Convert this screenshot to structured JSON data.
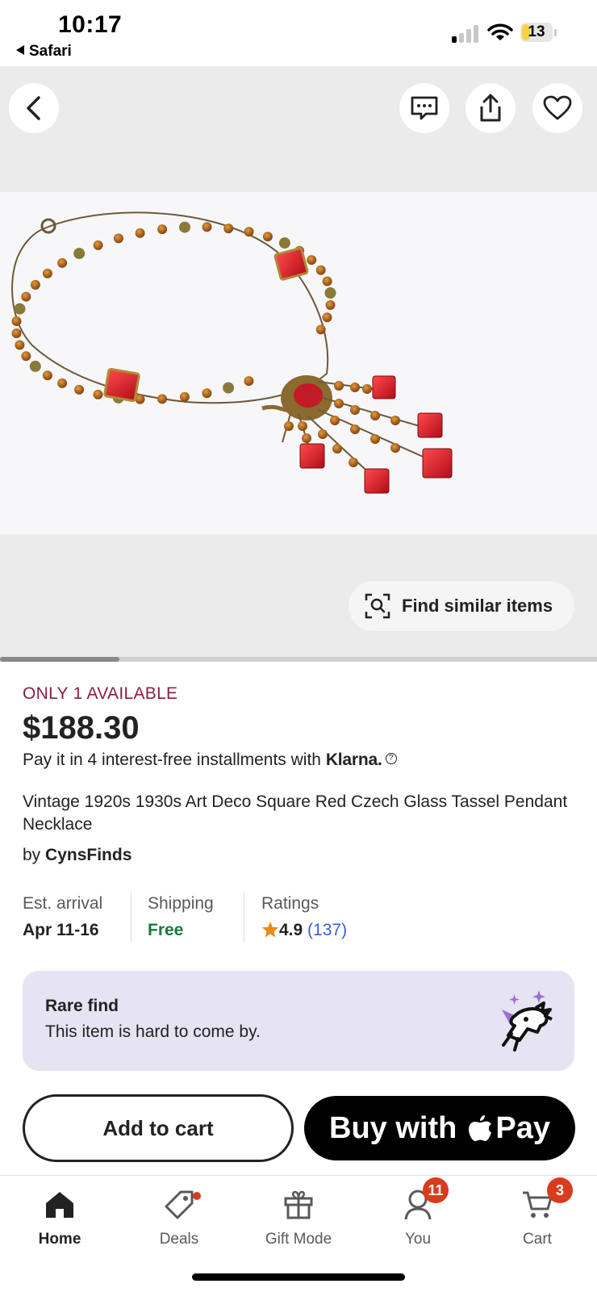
{
  "status_bar": {
    "time": "10:17",
    "back_app": "Safari",
    "battery_level": "13"
  },
  "gallery": {
    "find_similar_label": "Find similar items",
    "image_alt": "Vintage red and amber glass bead tassel necklace",
    "scroll_position": 0.2
  },
  "product": {
    "availability": "ONLY 1 AVAILABLE",
    "price": "$188.30",
    "installments_text": "Pay it in 4 interest-free installments with",
    "installments_brand": "Klarna.",
    "title": "Vintage 1920s 1930s Art Deco Square Red Czech Glass Tassel Pendant Necklace",
    "by_label": "by",
    "seller": "CynsFinds"
  },
  "meta": {
    "arrival_label": "Est. arrival",
    "arrival_value": "Apr 11-16",
    "shipping_label": "Shipping",
    "shipping_value": "Free",
    "ratings_label": "Ratings",
    "rating_value": "4.9",
    "rating_count": "(137)"
  },
  "rare_card": {
    "title": "Rare find",
    "description": "This item is hard to come by."
  },
  "actions": {
    "add_to_cart": "Add to cart",
    "buy_with": "Buy with",
    "pay": "Pay"
  },
  "tabs": [
    {
      "label": "Home",
      "icon": "home-icon",
      "active": true
    },
    {
      "label": "Deals",
      "icon": "tag-icon"
    },
    {
      "label": "Gift Mode",
      "icon": "gift-icon"
    },
    {
      "label": "You",
      "icon": "person-icon",
      "badge": "11"
    },
    {
      "label": "Cart",
      "icon": "cart-icon",
      "badge": "3"
    }
  ],
  "colors": {
    "availability": "#8a1f3d",
    "shipping_free": "#1a7a3b",
    "rating_link": "#3b5bd6",
    "rare_card_bg": "#e6e3f3",
    "badge": "#d93b1d",
    "star": "#e88a1a"
  }
}
